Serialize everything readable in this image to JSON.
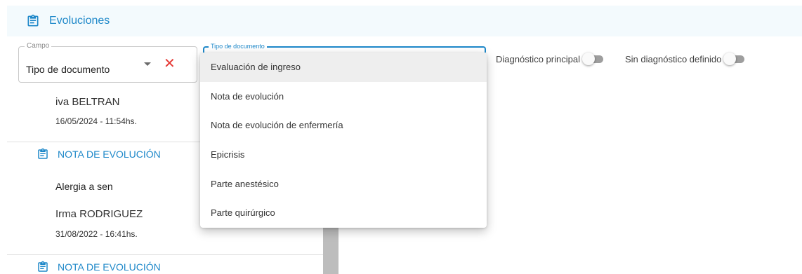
{
  "header": {
    "title": "Evoluciones",
    "icon": "clipboard-icon"
  },
  "filter_campo": {
    "legend": "Campo",
    "value": "Tipo de documento"
  },
  "filter_tipo": {
    "legend": "Tipo de documento"
  },
  "toggles": [
    {
      "label": "Diagnóstico principal",
      "on": false
    },
    {
      "label": "Sin diagnóstico definido",
      "on": false
    }
  ],
  "entries": [
    {
      "name": "iva BELTRAN",
      "date": "16/05/2024 - 11:54hs."
    },
    {
      "heading": "NOTA DE EVOLUCIÓN",
      "text": "Alergia a sen",
      "name": "Irma RODRIGUEZ",
      "date": "31/08/2022 - 16:41hs."
    },
    {
      "heading": "NOTA DE EVOLUCIÓN"
    }
  ],
  "dropdown_options": [
    "Evaluación de ingreso",
    "Nota de evolución",
    "Nota de evolución de enfermería",
    "Epicrisis",
    "Parte anestésico",
    "Parte quirúrgico"
  ],
  "colors": {
    "accent": "#1e88c9",
    "clear": "#e53935",
    "header_bg": "#f3fafd"
  }
}
